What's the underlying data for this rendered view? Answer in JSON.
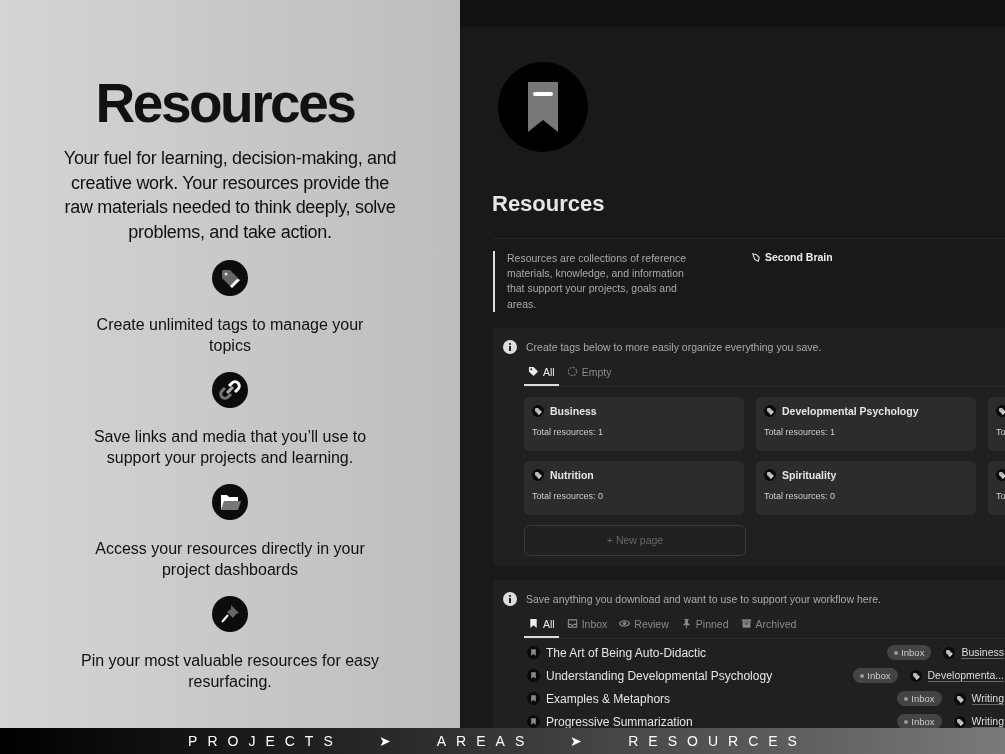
{
  "intro": {
    "title": "Resources",
    "description": "Your fuel for learning, decision-making, and creative work. Your resources provide the raw materials needed to think deeply, solve problems, and take action."
  },
  "features": [
    {
      "kind": "tag",
      "text": "Create unlimited tags to manage your topics"
    },
    {
      "kind": "link",
      "text": "Save links and media that you’ll use to support your projects and learning."
    },
    {
      "kind": "folder",
      "text": "Access your resources directly in your project dashboards"
    },
    {
      "kind": "pin",
      "text": "Pin your most valuable resources for easy resurfacing."
    }
  ],
  "page": {
    "title": "Resources",
    "quote": "Resources are collections of reference materials, knowledge, and information that support your projects, goals and areas.",
    "link": "Second Brain"
  },
  "tags_section": {
    "callout": "Create tags below to more easily organize everything you save.",
    "tabs": [
      {
        "kind": "tag",
        "label": "All",
        "selected": true
      },
      {
        "kind": "empty",
        "label": "Empty",
        "selected": false
      }
    ],
    "cards": [
      {
        "name": "Business",
        "total": "Total resources: 1"
      },
      {
        "name": "Developmental Psychology",
        "total": "Total resources: 1"
      },
      {
        "total": "To"
      },
      {
        "name": "Nutrition",
        "total": "Total resources: 0"
      },
      {
        "name": "Spirituality",
        "total": "Total resources: 0"
      },
      {
        "total": "To"
      }
    ],
    "new_page": "+ New page"
  },
  "saved_section": {
    "callout": "Save anything you download and want to use to support your workflow here.",
    "tabs": [
      {
        "kind": "bookmark",
        "label": "All",
        "selected": true
      },
      {
        "kind": "inbox",
        "label": "Inbox",
        "selected": false
      },
      {
        "kind": "eye",
        "label": "Review",
        "selected": false
      },
      {
        "kind": "pin",
        "label": "Pinned",
        "selected": false
      },
      {
        "kind": "archive",
        "label": "Archived",
        "selected": false
      }
    ],
    "items": [
      {
        "title": "The Art of Being Auto-Didactic",
        "status": "Inbox",
        "tag": "Business"
      },
      {
        "title": "Understanding Developmental Psychology",
        "status": "Inbox",
        "tag": "Developmenta..."
      },
      {
        "title": "Examples & Metaphors",
        "status": "Inbox",
        "tag": "Writing"
      },
      {
        "title": "Progressive Summarization",
        "status": "Inbox",
        "tag": "Writing"
      }
    ]
  },
  "breadcrumb": [
    {
      "label": "PROJECTS"
    },
    {
      "label": "➤"
    },
    {
      "label": "AREAS"
    },
    {
      "label": "➤"
    },
    {
      "label": "RESOURCES"
    }
  ]
}
